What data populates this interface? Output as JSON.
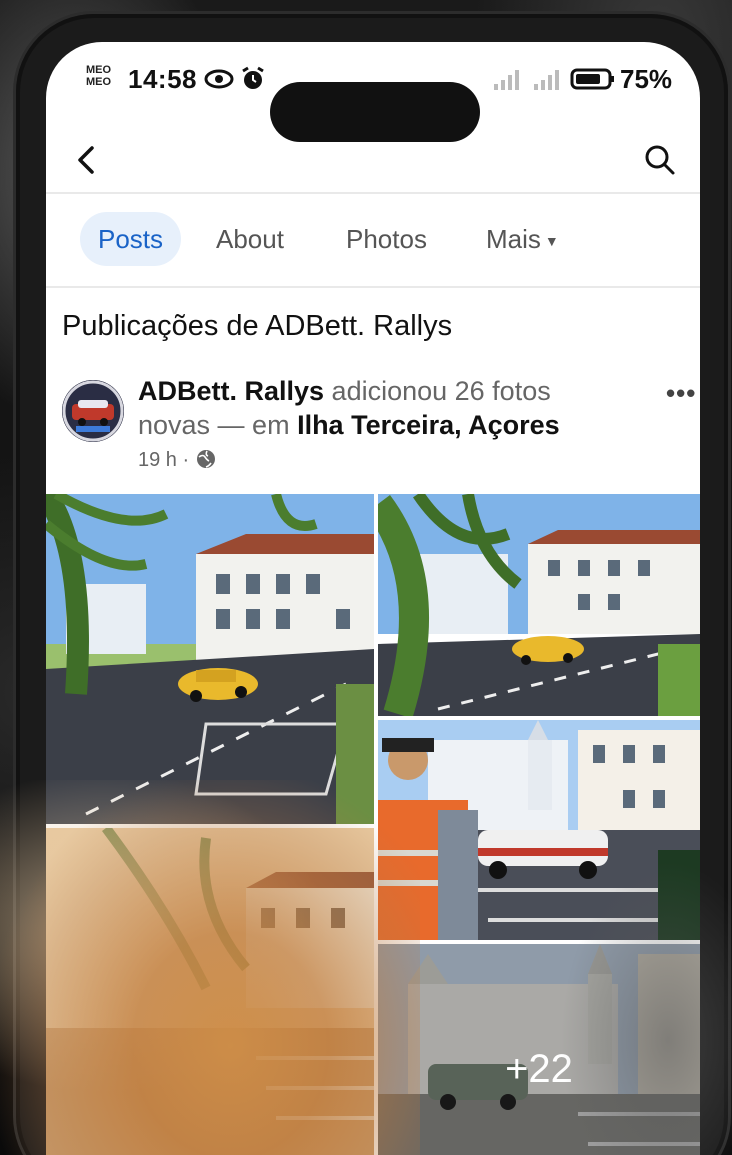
{
  "status_bar": {
    "carrier_line1": "MEO",
    "carrier_line2": "MEO",
    "time": "14:58",
    "battery_percent": "75%",
    "icons": [
      "eye-icon",
      "alarm-icon",
      "signal-icon",
      "signal-icon",
      "battery-icon"
    ]
  },
  "top_nav": {
    "back_icon": "chevron-left-icon",
    "search_icon": "search-icon"
  },
  "tabs": [
    {
      "label": "Posts",
      "active": true
    },
    {
      "label": "About",
      "active": false
    },
    {
      "label": "Photos",
      "active": false
    },
    {
      "label": "Mais",
      "active": false,
      "icon": "caret-down-icon"
    }
  ],
  "section": {
    "title": "Publicações de ADBett. Rallys"
  },
  "post": {
    "author": "ADBett. Rallys",
    "action": " adicionou 26 fotos novas — em ",
    "location": "Ilha Terceira, Açores",
    "time": "19 h",
    "separator": " · ",
    "privacy_icon": "globe-icon",
    "more_label": "•••",
    "more_photos_label": "+22"
  },
  "colors": {
    "accent": "#1a63c7",
    "tab_active_bg": "#e7f0fb",
    "text_primary": "#111111",
    "text_secondary": "#666666"
  }
}
